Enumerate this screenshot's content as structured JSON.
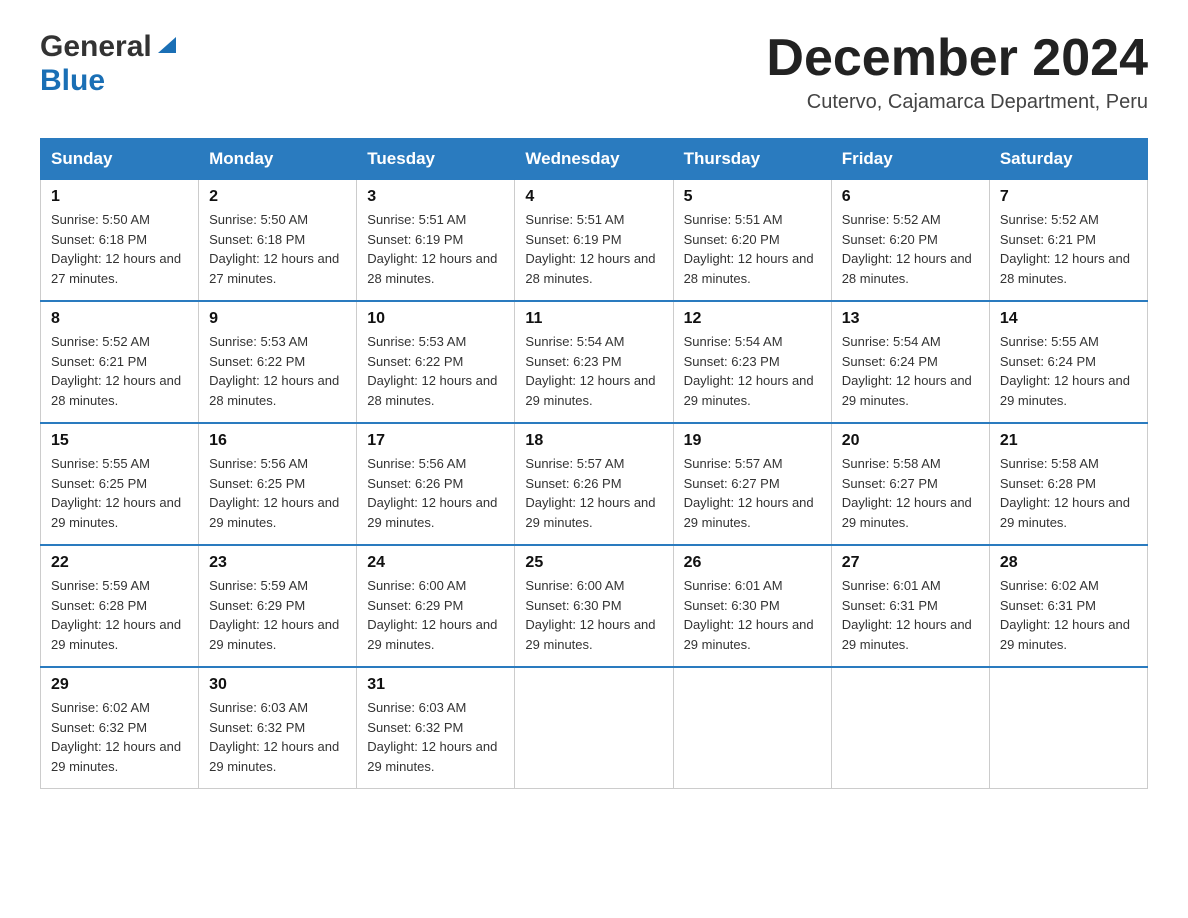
{
  "header": {
    "logo_general": "General",
    "logo_blue": "Blue",
    "title": "December 2024",
    "subtitle": "Cutervo, Cajamarca Department, Peru"
  },
  "days_of_week": [
    "Sunday",
    "Monday",
    "Tuesday",
    "Wednesday",
    "Thursday",
    "Friday",
    "Saturday"
  ],
  "weeks": [
    [
      {
        "day": "1",
        "sunrise": "5:50 AM",
        "sunset": "6:18 PM",
        "daylight": "12 hours and 27 minutes."
      },
      {
        "day": "2",
        "sunrise": "5:50 AM",
        "sunset": "6:18 PM",
        "daylight": "12 hours and 27 minutes."
      },
      {
        "day": "3",
        "sunrise": "5:51 AM",
        "sunset": "6:19 PM",
        "daylight": "12 hours and 28 minutes."
      },
      {
        "day": "4",
        "sunrise": "5:51 AM",
        "sunset": "6:19 PM",
        "daylight": "12 hours and 28 minutes."
      },
      {
        "day": "5",
        "sunrise": "5:51 AM",
        "sunset": "6:20 PM",
        "daylight": "12 hours and 28 minutes."
      },
      {
        "day": "6",
        "sunrise": "5:52 AM",
        "sunset": "6:20 PM",
        "daylight": "12 hours and 28 minutes."
      },
      {
        "day": "7",
        "sunrise": "5:52 AM",
        "sunset": "6:21 PM",
        "daylight": "12 hours and 28 minutes."
      }
    ],
    [
      {
        "day": "8",
        "sunrise": "5:52 AM",
        "sunset": "6:21 PM",
        "daylight": "12 hours and 28 minutes."
      },
      {
        "day": "9",
        "sunrise": "5:53 AM",
        "sunset": "6:22 PM",
        "daylight": "12 hours and 28 minutes."
      },
      {
        "day": "10",
        "sunrise": "5:53 AM",
        "sunset": "6:22 PM",
        "daylight": "12 hours and 28 minutes."
      },
      {
        "day": "11",
        "sunrise": "5:54 AM",
        "sunset": "6:23 PM",
        "daylight": "12 hours and 29 minutes."
      },
      {
        "day": "12",
        "sunrise": "5:54 AM",
        "sunset": "6:23 PM",
        "daylight": "12 hours and 29 minutes."
      },
      {
        "day": "13",
        "sunrise": "5:54 AM",
        "sunset": "6:24 PM",
        "daylight": "12 hours and 29 minutes."
      },
      {
        "day": "14",
        "sunrise": "5:55 AM",
        "sunset": "6:24 PM",
        "daylight": "12 hours and 29 minutes."
      }
    ],
    [
      {
        "day": "15",
        "sunrise": "5:55 AM",
        "sunset": "6:25 PM",
        "daylight": "12 hours and 29 minutes."
      },
      {
        "day": "16",
        "sunrise": "5:56 AM",
        "sunset": "6:25 PM",
        "daylight": "12 hours and 29 minutes."
      },
      {
        "day": "17",
        "sunrise": "5:56 AM",
        "sunset": "6:26 PM",
        "daylight": "12 hours and 29 minutes."
      },
      {
        "day": "18",
        "sunrise": "5:57 AM",
        "sunset": "6:26 PM",
        "daylight": "12 hours and 29 minutes."
      },
      {
        "day": "19",
        "sunrise": "5:57 AM",
        "sunset": "6:27 PM",
        "daylight": "12 hours and 29 minutes."
      },
      {
        "day": "20",
        "sunrise": "5:58 AM",
        "sunset": "6:27 PM",
        "daylight": "12 hours and 29 minutes."
      },
      {
        "day": "21",
        "sunrise": "5:58 AM",
        "sunset": "6:28 PM",
        "daylight": "12 hours and 29 minutes."
      }
    ],
    [
      {
        "day": "22",
        "sunrise": "5:59 AM",
        "sunset": "6:28 PM",
        "daylight": "12 hours and 29 minutes."
      },
      {
        "day": "23",
        "sunrise": "5:59 AM",
        "sunset": "6:29 PM",
        "daylight": "12 hours and 29 minutes."
      },
      {
        "day": "24",
        "sunrise": "6:00 AM",
        "sunset": "6:29 PM",
        "daylight": "12 hours and 29 minutes."
      },
      {
        "day": "25",
        "sunrise": "6:00 AM",
        "sunset": "6:30 PM",
        "daylight": "12 hours and 29 minutes."
      },
      {
        "day": "26",
        "sunrise": "6:01 AM",
        "sunset": "6:30 PM",
        "daylight": "12 hours and 29 minutes."
      },
      {
        "day": "27",
        "sunrise": "6:01 AM",
        "sunset": "6:31 PM",
        "daylight": "12 hours and 29 minutes."
      },
      {
        "day": "28",
        "sunrise": "6:02 AM",
        "sunset": "6:31 PM",
        "daylight": "12 hours and 29 minutes."
      }
    ],
    [
      {
        "day": "29",
        "sunrise": "6:02 AM",
        "sunset": "6:32 PM",
        "daylight": "12 hours and 29 minutes."
      },
      {
        "day": "30",
        "sunrise": "6:03 AM",
        "sunset": "6:32 PM",
        "daylight": "12 hours and 29 minutes."
      },
      {
        "day": "31",
        "sunrise": "6:03 AM",
        "sunset": "6:32 PM",
        "daylight": "12 hours and 29 minutes."
      },
      null,
      null,
      null,
      null
    ]
  ],
  "labels": {
    "sunrise_prefix": "Sunrise: ",
    "sunset_prefix": "Sunset: ",
    "daylight_prefix": "Daylight: "
  }
}
